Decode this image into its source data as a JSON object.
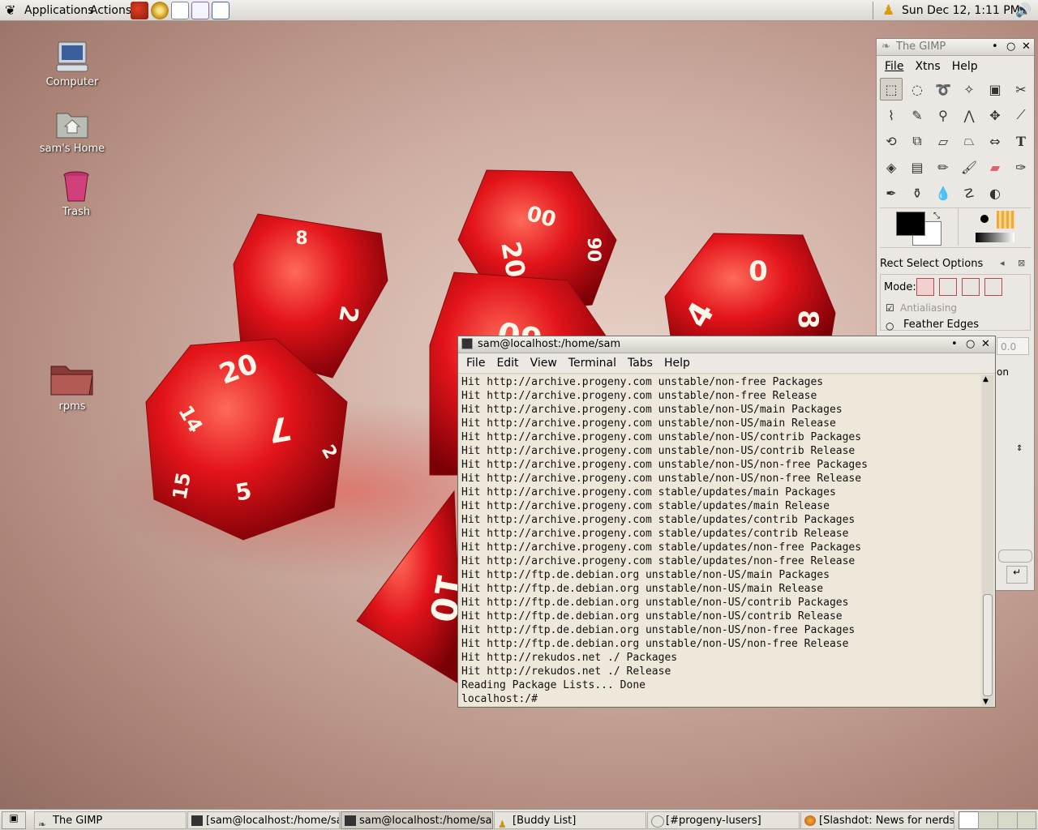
{
  "top_panel": {
    "applications": "Applications",
    "actions": "Actions",
    "clock": "Sun Dec 12,  1:11 PM"
  },
  "desktop": {
    "icons": [
      {
        "label": "Computer"
      },
      {
        "label": "sam's Home"
      },
      {
        "label": "Trash"
      },
      {
        "label": "rpms"
      }
    ]
  },
  "dice_numbers": [
    "8",
    "2",
    "20",
    "7",
    "2",
    "15",
    "5",
    "14",
    "00",
    "20",
    "90",
    "60",
    "10",
    "4",
    "0",
    "8"
  ],
  "gimp": {
    "title": "The GIMP",
    "menu": [
      "File",
      "Xtns",
      "Help"
    ],
    "options_title": "Rect Select Options",
    "mode_label": "Mode:",
    "antialiasing": "Antialiasing",
    "feather": "Feather Edges",
    "value": "0.0",
    "partial": "on"
  },
  "terminal": {
    "title": "sam@localhost:/home/sam",
    "menu": [
      "File",
      "Edit",
      "View",
      "Terminal",
      "Tabs",
      "Help"
    ],
    "lines": [
      "Hit http://archive.progeny.com unstable/non-free Packages",
      "Hit http://archive.progeny.com unstable/non-free Release",
      "Hit http://archive.progeny.com unstable/non-US/main Packages",
      "Hit http://archive.progeny.com unstable/non-US/main Release",
      "Hit http://archive.progeny.com unstable/non-US/contrib Packages",
      "Hit http://archive.progeny.com unstable/non-US/contrib Release",
      "Hit http://archive.progeny.com unstable/non-US/non-free Packages",
      "Hit http://archive.progeny.com unstable/non-US/non-free Release",
      "Hit http://archive.progeny.com stable/updates/main Packages",
      "Hit http://archive.progeny.com stable/updates/main Release",
      "Hit http://archive.progeny.com stable/updates/contrib Packages",
      "Hit http://archive.progeny.com stable/updates/contrib Release",
      "Hit http://archive.progeny.com stable/updates/non-free Packages",
      "Hit http://archive.progeny.com stable/updates/non-free Release",
      "Hit http://ftp.de.debian.org unstable/non-US/main Packages",
      "Hit http://ftp.de.debian.org unstable/non-US/main Release",
      "Hit http://ftp.de.debian.org unstable/non-US/contrib Packages",
      "Hit http://ftp.de.debian.org unstable/non-US/contrib Release",
      "Hit http://ftp.de.debian.org unstable/non-US/non-free Packages",
      "Hit http://ftp.de.debian.org unstable/non-US/non-free Release",
      "Hit http://rekudos.net ./ Packages",
      "Hit http://rekudos.net ./ Release",
      "Reading Package Lists... Done",
      "localhost:/# "
    ]
  },
  "taskbar": {
    "tasks": [
      {
        "label": "The GIMP"
      },
      {
        "label": "[sam@localhost:/home/sam"
      },
      {
        "label": "sam@localhost:/home/sam"
      },
      {
        "label": "[Buddy List]"
      },
      {
        "label": "[#progeny-lusers]"
      },
      {
        "label": "[Slashdot: News for nerds, s"
      }
    ]
  }
}
